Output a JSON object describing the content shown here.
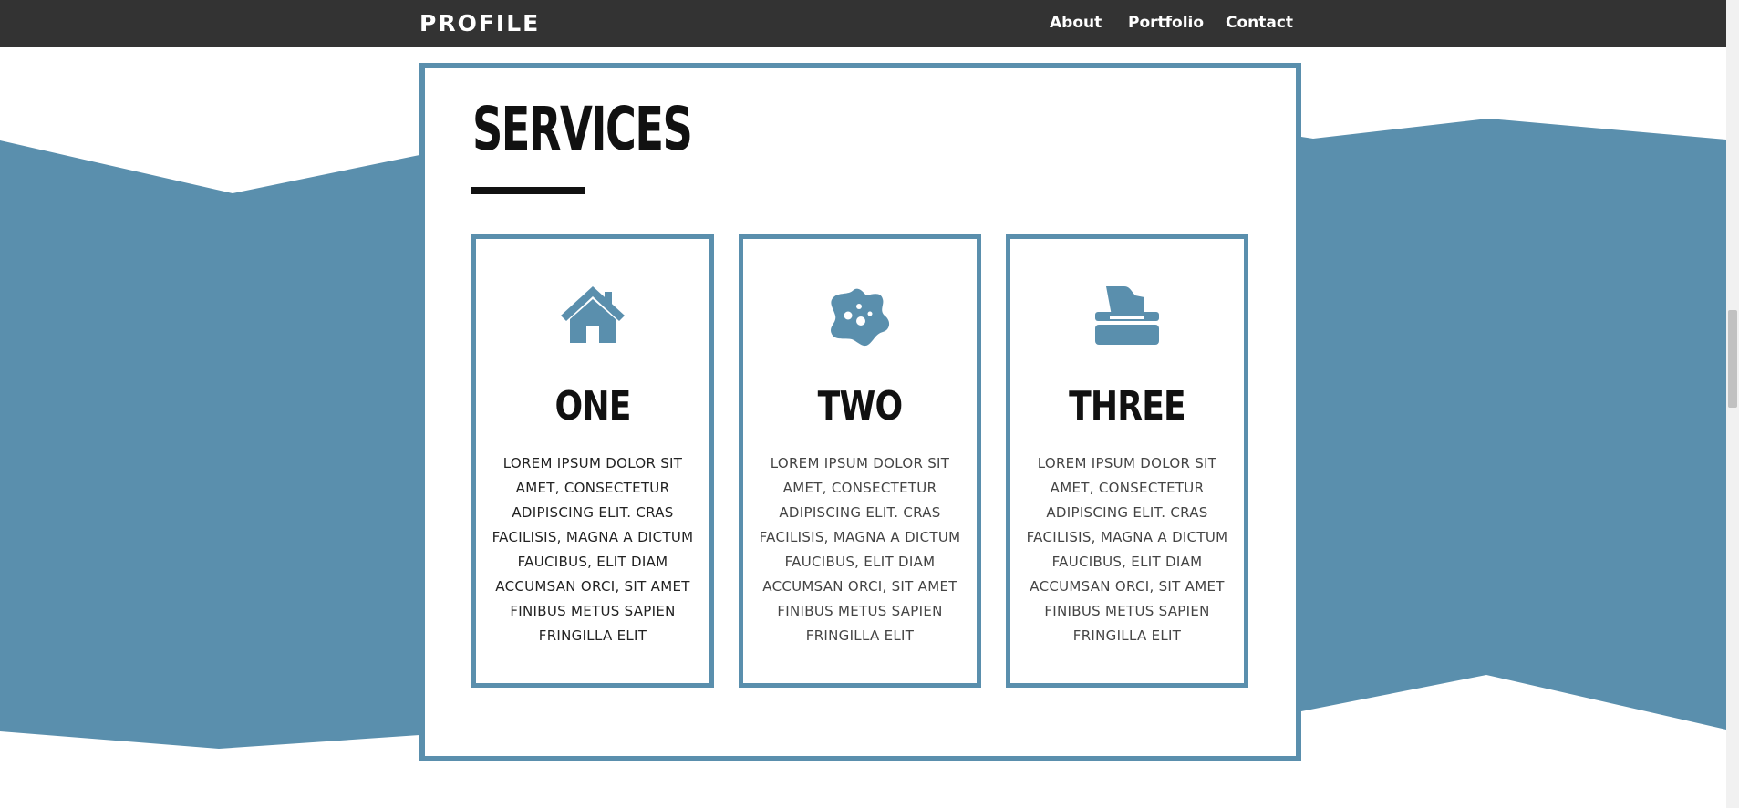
{
  "navbar": {
    "brand": "PROFILE",
    "links": [
      "About",
      "Portfolio",
      "Contact"
    ]
  },
  "services": {
    "title": "SERVICES",
    "cards": [
      {
        "icon": "house-icon",
        "title": "ONE",
        "text": "Lorem ipsum dolor sit amet, consectetur adipiscing elit. Cras facilisis, magna a dictum faucibus, elit diam accumsan orci, sit amet finibus metus sapien fringilla elit"
      },
      {
        "icon": "germ-icon",
        "title": "TWO",
        "text": "Lorem ipsum dolor sit amet, consectetur adipiscing elit. Cras facilisis, magna a dictum faucibus, elit diam accumsan orci, sit amet finibus metus sapien fringilla elit"
      },
      {
        "icon": "tissue-box-icon",
        "title": "THREE",
        "text": "Lorem ipsum dolor sit amet, consectetur adipiscing elit. Cras facilisis, magna a dictum faucibus, elit diam accumsan orci, sit amet finibus metus sapien fringilla elit"
      }
    ]
  },
  "colors": {
    "accent": "#5a8fad",
    "navbar": "#333333",
    "text": "#111111"
  }
}
